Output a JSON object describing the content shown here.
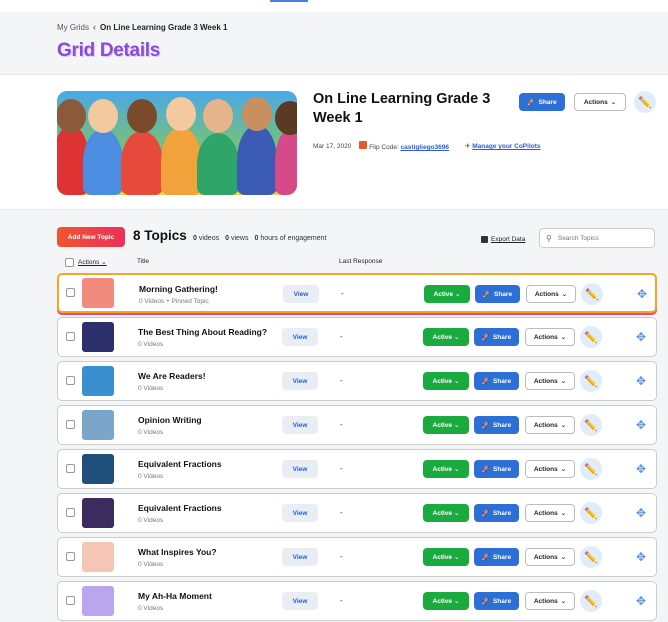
{
  "breadcrumb": {
    "parent": "My Grids",
    "current": "On Line Learning Grade 3 Week 1"
  },
  "page_title": "Grid Details",
  "grid": {
    "title": "On Line Learning Grade 3 Week 1",
    "date": "Mar 17, 2020",
    "flip_code_label": "Flip Code:",
    "flip_code": "castigliego3696",
    "copilots_link": "Manage your CoPilots",
    "share_label": "Share",
    "actions_label": "Actions"
  },
  "toolbar": {
    "add_label": "Add New Topic",
    "topics_count": "8 Topics",
    "videos_count": "0",
    "videos_label": "videos",
    "views_count": "0",
    "views_label": "views",
    "hours_count": "0",
    "hours_label": "hours of engagement",
    "export_label": "Export Data",
    "search_placeholder": "Search Topics"
  },
  "columns": {
    "actions": "Actions",
    "title": "Title",
    "last_response": "Last Response"
  },
  "row_labels": {
    "view": "View",
    "active": "Active",
    "share": "Share",
    "actions": "Actions",
    "dash": "-"
  },
  "topics": [
    {
      "title": "Morning Gathering!",
      "subtitle": "0 Videos + Pinned Topic",
      "thumb_color": "#f28b7d"
    },
    {
      "title": "The Best Thing About Reading?",
      "subtitle": "0 Videos",
      "thumb_color": "#2b2f6b"
    },
    {
      "title": "We Are Readers!",
      "subtitle": "0 Videos",
      "thumb_color": "#3a8fd1"
    },
    {
      "title": "Opinion Writing",
      "subtitle": "0 Videos",
      "thumb_color": "#7aa6c9"
    },
    {
      "title": "Equivalent Fractions",
      "subtitle": "0 Videos",
      "thumb_color": "#1f4f7a"
    },
    {
      "title": "Equivalent Fractions",
      "subtitle": "0 Videos",
      "thumb_color": "#3b2b5e"
    },
    {
      "title": "What Inspires You?",
      "subtitle": "0 Videos",
      "thumb_color": "#f6c6b4"
    },
    {
      "title": "My Ah-Ha Moment",
      "subtitle": "0 Videos",
      "thumb_color": "#b9a6ee"
    }
  ],
  "colors": {
    "accent": "#8a4bdc",
    "share": "#2c6fd6",
    "active": "#1aab3f",
    "add": "#ee2f5a",
    "pinned_border": "#f4a623"
  },
  "icons": {
    "breadcrumb_sep": "chevron-left-icon",
    "edit": "pencil-icon",
    "move": "move-arrows-icon",
    "share": "rocket-icon",
    "search": "search-icon",
    "export": "export-icon"
  }
}
